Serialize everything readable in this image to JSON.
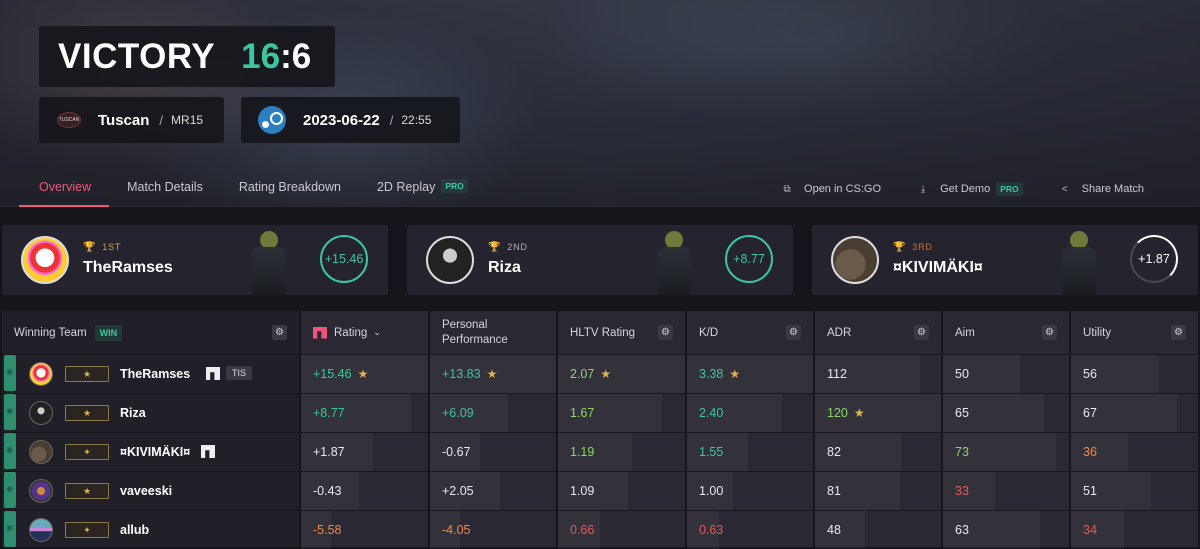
{
  "header": {
    "result": "VICTORY",
    "score_win": "16",
    "score_sep": ":",
    "score_lose": "6",
    "map_name": "Tuscan",
    "map_logo_text": "TUSCAN",
    "mode": "MR15",
    "date": "2023-06-22",
    "time": "22:55",
    "slash": "/"
  },
  "tabs": [
    {
      "label": "Overview"
    },
    {
      "label": "Match Details"
    },
    {
      "label": "Rating Breakdown"
    },
    {
      "label": "2D Replay",
      "badge": "PRO"
    }
  ],
  "actions": {
    "open": "Open in CS:GO",
    "demo": "Get Demo",
    "demo_badge": "PRO",
    "share": "Share Match"
  },
  "top_players": [
    {
      "place": "1ST",
      "name": "TheRamses",
      "score": "+15.46"
    },
    {
      "place": "2ND",
      "name": "Riza",
      "score": "+8.77"
    },
    {
      "place": "3RD",
      "name": "¤KIVIMÄKI¤",
      "score": "+1.87"
    }
  ],
  "table": {
    "team_label": "Winning Team",
    "win_badge": "WIN",
    "columns": {
      "rating": "Rating",
      "personal": "Personal Performance",
      "hltv": "HLTV Rating",
      "kd": "K/D",
      "adr": "ADR",
      "aim": "Aim",
      "utility": "Utility"
    },
    "rows": [
      {
        "name": "TheRamses",
        "tag": "TIS",
        "rating": "+15.46",
        "personal": "+13.83",
        "hltv": "2.07",
        "kd": "3.38",
        "adr": "112",
        "aim": "50",
        "utility": "56"
      },
      {
        "name": "Riza",
        "rating": "+8.77",
        "personal": "+6.09",
        "hltv": "1.67",
        "kd": "2.40",
        "adr": "120",
        "aim": "65",
        "utility": "67"
      },
      {
        "name": "¤KIVIMÄKI¤",
        "rating": "+1.87",
        "personal": "-0.67",
        "hltv": "1.19",
        "kd": "1.55",
        "adr": "82",
        "aim": "73",
        "utility": "36"
      },
      {
        "name": "vaveeski",
        "rating": "-0.43",
        "personal": "+2.05",
        "hltv": "1.09",
        "kd": "1.00",
        "adr": "81",
        "aim": "33",
        "utility": "51"
      },
      {
        "name": "allub",
        "rating": "-5.58",
        "personal": "-4.05",
        "hltv": "0.66",
        "kd": "0.63",
        "adr": "48",
        "aim": "63",
        "utility": "34"
      }
    ]
  },
  "colors": {
    "accent": "#f0567a",
    "win_green": "#3bc6a2",
    "good_green": "#8dd46a",
    "bad_red": "#e45a5a",
    "warn_orange": "#f08a4a",
    "star_gold": "#e0b44e"
  }
}
